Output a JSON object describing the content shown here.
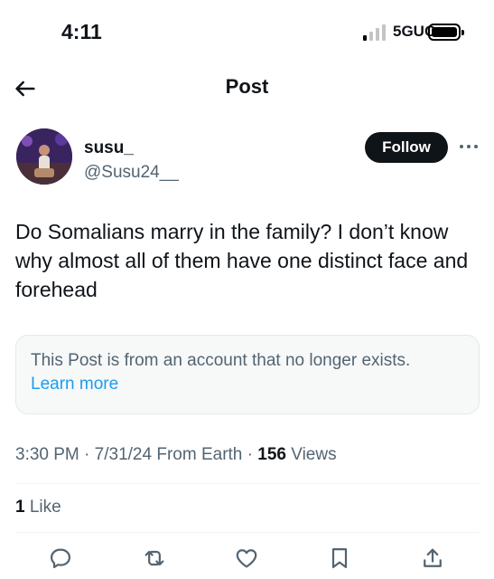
{
  "status_bar": {
    "time": "4:11",
    "network": "5GUC"
  },
  "header": {
    "title": "Post"
  },
  "author": {
    "display_name": "susu_",
    "handle": "@Susu24__",
    "follow_label": "Follow"
  },
  "post": {
    "text": "Do Somalians marry in the family? I don’t know why almost all of them have one distinct face and forehead",
    "notice": "This Post is from an account that no longer exists.",
    "notice_link": "Learn more",
    "time": "3:30 PM",
    "date": "7/31/24",
    "source": "From Earth",
    "views_count": "156",
    "views_label": "Views",
    "likes_count": "1",
    "likes_label": "Like"
  },
  "actions": [
    "reply-icon",
    "repost-icon",
    "like-icon",
    "bookmark-icon",
    "share-icon"
  ]
}
